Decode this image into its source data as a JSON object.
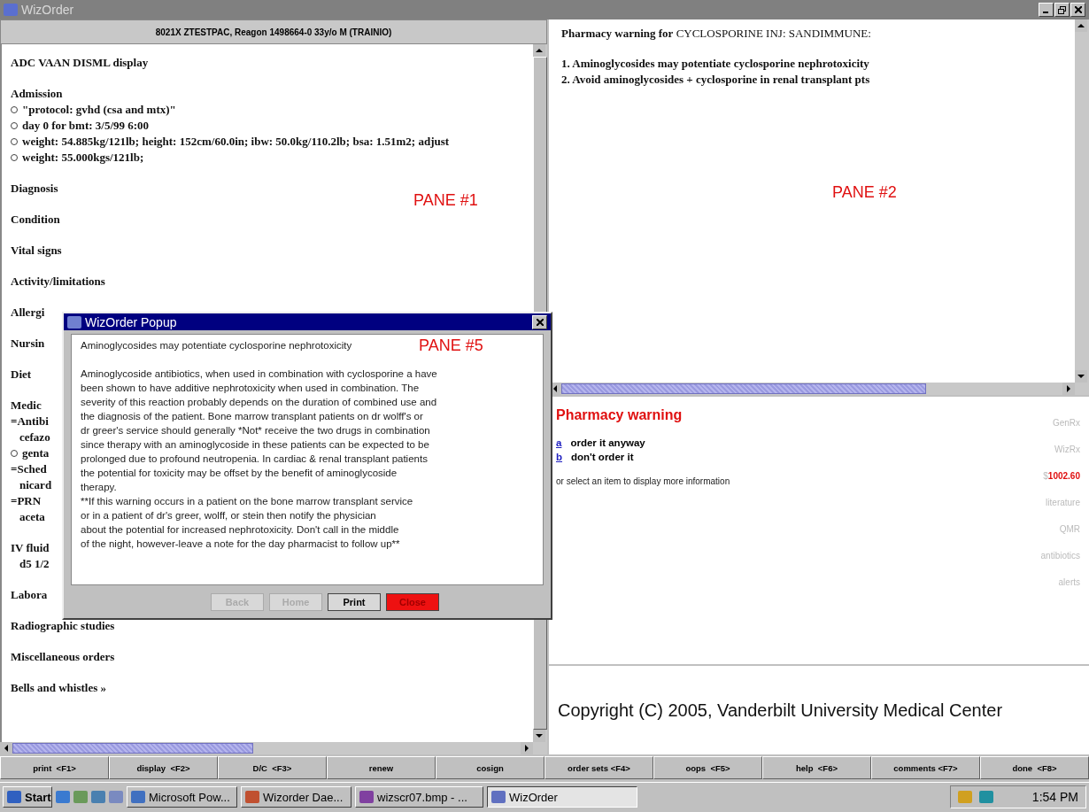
{
  "window": {
    "title": "WizOrder"
  },
  "patient_header": "8021X ZTESTPAC, Reagon 1498664-0 33y/o M (TRAINIO)",
  "left_pane": {
    "annotation": "PANE #1",
    "sections": [
      {
        "title": "ADC VAAN DISML display"
      },
      {
        "title": "Admission",
        "lines": [
          {
            "kind": "bullet",
            "text": "\"protocol: gvhd (csa and mtx)\""
          },
          {
            "kind": "bullet",
            "text": "day 0 for bmt:  3/5/99 6:00"
          },
          {
            "kind": "bullet",
            "text": "weight: 54.885kg/121lb;  height: 152cm/60.0in;  ibw: 50.0kg/110.2lb;  bsa: 1.51m2;  adjust"
          },
          {
            "kind": "bullet",
            "text": "weight: 55.000kgs/121lb;"
          }
        ]
      },
      {
        "title": "Diagnosis"
      },
      {
        "title": "Condition"
      },
      {
        "title": "Vital signs"
      },
      {
        "title": "Activity/limitations"
      },
      {
        "title": "Allergi"
      },
      {
        "title": "Nursin"
      },
      {
        "title": "Diet"
      },
      {
        "title": "Medic",
        "lines": [
          {
            "kind": "plain",
            "text": "=Antibi"
          },
          {
            "kind": "indent",
            "text": "cefazo"
          },
          {
            "kind": "bullet",
            "text": "genta"
          },
          {
            "kind": "plain",
            "text": "=Sched"
          },
          {
            "kind": "indent",
            "text": "nicard"
          },
          {
            "kind": "plain",
            "text": "=PRN"
          },
          {
            "kind": "indent",
            "text": "aceta"
          }
        ]
      },
      {
        "title": "IV fluid",
        "lines": [
          {
            "kind": "indent",
            "text": "d5 1/2"
          }
        ]
      },
      {
        "title": "Labora"
      },
      {
        "title": "Radiographic studies"
      },
      {
        "title": "Miscellaneous orders"
      },
      {
        "title": "Bells and whistles »"
      }
    ]
  },
  "warning_pane": {
    "annotation": "PANE #2",
    "title": "Pharmacy warning for CYCLOSPORINE INJ: SANDIMMUNE:",
    "items": [
      "1. Aminoglycosides may potentiate cyclosporine nephrotoxicity",
      "2. Avoid aminoglycosides + cyclosporine in renal transplant pts"
    ]
  },
  "action_pane": {
    "title": "Pharmacy warning",
    "options": [
      {
        "key": "a",
        "label": "order it anyway"
      },
      {
        "key": "b",
        "label": "don't order it"
      }
    ],
    "hint": "or select an item to display more information",
    "side_links": [
      {
        "kind": "link",
        "text": "GenRx"
      },
      {
        "kind": "link",
        "text": "WizRx"
      },
      {
        "kind": "price",
        "prefix": "$",
        "text": "1002.60"
      },
      {
        "kind": "link",
        "text": "literature"
      },
      {
        "kind": "link",
        "text": "QMR"
      },
      {
        "kind": "link",
        "text": "antibiotics"
      },
      {
        "kind": "link",
        "text": "alerts"
      }
    ]
  },
  "copyright": "Copyright (C) 2005, Vanderbilt University Medical Center",
  "popup": {
    "title": "WizOrder Popup",
    "annotation": "PANE #5",
    "heading": "Aminoglycosides may potentiate cyclosporine nephrotoxicity",
    "body": [
      "Aminoglycoside antibiotics, when used in combination with cyclosporine a have",
      "been shown to have additive nephrotoxicity when used in combination. The",
      "severity of this reaction probably depends on the duration of combined use and",
      "the diagnosis of the patient. Bone marrow transplant patients on dr wolff's or",
      "dr greer's service should generally *Not* receive the two drugs in combination",
      "since therapy with an aminoglycoside in these patients can be expected to be",
      "prolonged due to profound neutropenia. In cardiac & renal transplant patients",
      "the potential for toxicity may be offset by the benefit of aminoglycoside",
      "therapy.",
      "**If this warning occurs in a patient on the bone marrow transplant service",
      "or in a patient of dr's greer, wolff, or stein then notify the physician",
      "about the potential for increased nephrotoxicity. Don't call in the middle",
      "of the night, however-leave a note for the day pharmacist to follow up**"
    ],
    "buttons": [
      {
        "label": "Back",
        "kind": "normal",
        "disabled": true
      },
      {
        "label": "Home",
        "kind": "normal",
        "disabled": true
      },
      {
        "label": "Print",
        "kind": "normal",
        "disabled": false
      },
      {
        "label": "Close",
        "kind": "danger",
        "disabled": false
      }
    ]
  },
  "function_keys": [
    "print  <F1>",
    "display  <F2>",
    "D/C  <F3>",
    "renew",
    "cosign",
    "order sets <F4>",
    "oops  <F5>",
    "help  <F6>",
    "comments <F7>",
    "done  <F8>"
  ],
  "taskbar": {
    "start": "Start",
    "tasks": [
      {
        "label": "Microsoft Pow...",
        "selected": false
      },
      {
        "label": "Wizorder Dae...",
        "selected": false
      },
      {
        "label": "wizscr07.bmp - ...",
        "selected": false
      },
      {
        "label": "WizOrder",
        "selected": true
      }
    ],
    "clock": "1:54 PM"
  }
}
